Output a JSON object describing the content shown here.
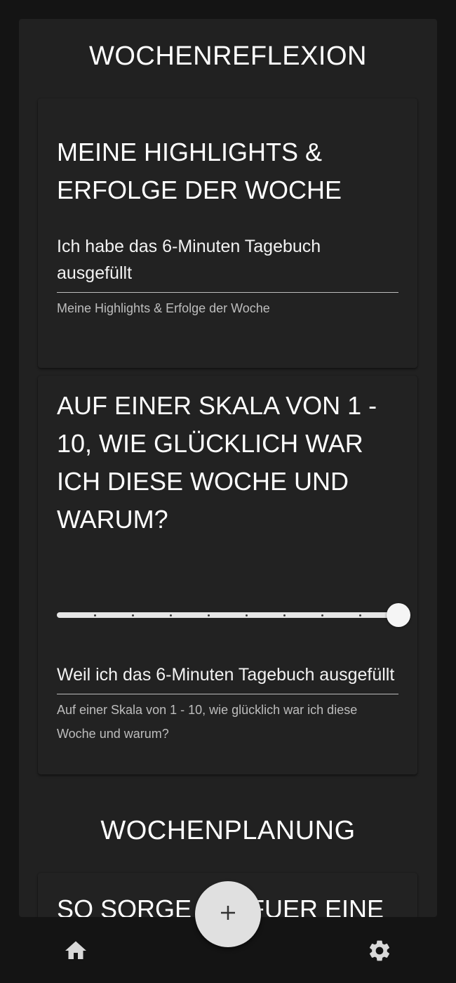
{
  "weekly_reflection": {
    "heading": "WOCHENREFLEXION",
    "highlights_card": {
      "title": "MEINE HIGHLIGHTS & ERFOLGE DER WOCHE",
      "value": "Ich habe das 6-Minuten Tagebuch ausgefüllt",
      "helper": "Meine Highlights & Erfolge der Woche"
    },
    "happiness_card": {
      "title": "AUF EINER SKALA VON 1 - 10, WIE GLÜCKLICH WAR ICH DIESE WOCHE UND WARUM?",
      "slider": {
        "min": 1,
        "max": 10,
        "value": 10
      },
      "value": "Weil ich das 6-Minuten Tagebuch ausgefüllt habe",
      "helper": "Auf einer Skala von 1 - 10, wie glücklich war ich diese Woche und warum?"
    }
  },
  "weekly_planning": {
    "heading": "WOCHENPLANUNG",
    "partial_card_title": "SO SORGE ICH FUER EINE"
  },
  "bottom_nav": {
    "left_icon": "home-icon",
    "fab_icon": "plus-icon",
    "right_icon": "gear-icon"
  },
  "colors": {
    "background": "#141414",
    "surface": "#212121",
    "text": "#ffffff",
    "helper_text": "#bdbdbd",
    "fab": "#e0e0e0",
    "nav_icon": "#d9d9d9"
  }
}
